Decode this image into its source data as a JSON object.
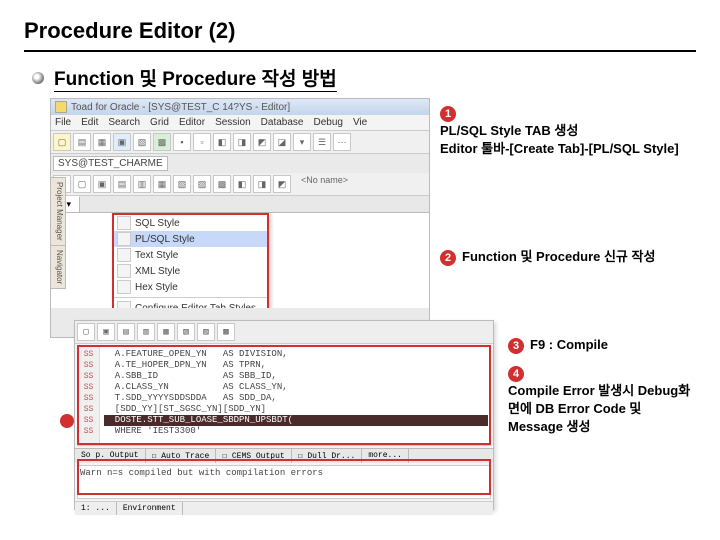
{
  "title": "Procedure Editor (2)",
  "subtitle": "Function 및 Procedure 작성 방법",
  "app": {
    "window_title": "Toad for Oracle - [SYS@TEST_C 14?YS - Editor]",
    "menus": [
      "File",
      "Edit",
      "Search",
      "Grid",
      "Editor",
      "Session",
      "Database",
      "Debug",
      "Vie"
    ],
    "connection": "SYS@TEST_CHARME",
    "tab_label": "1 ▾",
    "side_tabs": [
      "Project Manager",
      "Navigator"
    ],
    "dropdown": {
      "items": [
        "SQL Style",
        "PL/SQL Style",
        "Text Style",
        "XML Style",
        "Hex Style"
      ],
      "configure": "Configure Editor Tab Styles...",
      "selected": "PL/SQL Style"
    },
    "tbar_right_label": "<No name>"
  },
  "shot2": {
    "code_lines": [
      "  A.FEATURE_OPEN_YN   AS DIVISION,",
      "  A.TE_HOPER_DPN_YN   AS TPRN,",
      "  A.SBB_ID            AS SBB_ID,",
      "  A.CLASS_YN          AS CLASS_YN,",
      "  T.SDD_YYYYSDDSDDA   AS SDD_DA,",
      "  [SDD_YY][ST_SGSC_YN][SDD_YN]",
      "  DOSTE.STT_SUB_LOASE_SBDPN_UPSBDT(",
      "  WHERE 'IEST3300'"
    ],
    "gutter": [
      "SS",
      "SS",
      "SS",
      "SS",
      "SS",
      "SS",
      "SS",
      "SS"
    ],
    "bottom_tabs_left": "So p. Output",
    "checks": [
      "Auto Trace",
      "CEMS Output",
      "Dull Dr...",
      "more..."
    ],
    "status_text": "Warn n=s compiled but with compilation errors",
    "env_tabs": [
      "1: ...",
      "Environment"
    ]
  },
  "annotations": {
    "a1": {
      "num": "1",
      "text": "PL/SQL Style TAB 생성\nEditor 툴바-[Create Tab]-[PL/SQL Style]"
    },
    "a2": {
      "num": "2",
      "text": "Function 및 Procedure 신규 작성"
    },
    "a3": {
      "num": "3",
      "text": "F9 : Compile"
    },
    "a4": {
      "num": "4",
      "text": "Compile Error 발생시 Debug화면에 DB Error Code 및 Message 생성"
    }
  }
}
